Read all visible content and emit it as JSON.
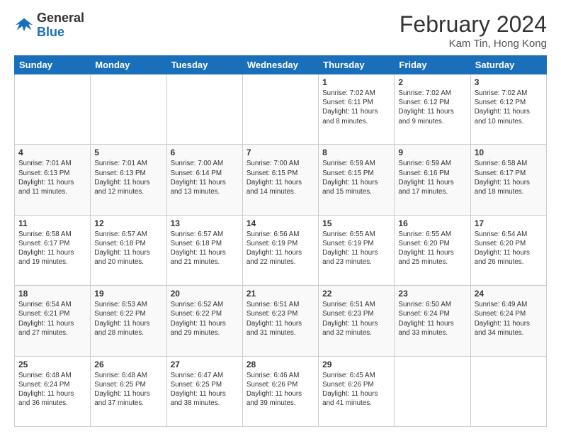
{
  "header": {
    "logo_general": "General",
    "logo_blue": "Blue",
    "month_year": "February 2024",
    "location": "Kam Tin, Hong Kong"
  },
  "days_of_week": [
    "Sunday",
    "Monday",
    "Tuesday",
    "Wednesday",
    "Thursday",
    "Friday",
    "Saturday"
  ],
  "weeks": [
    [
      {
        "day": "",
        "info": ""
      },
      {
        "day": "",
        "info": ""
      },
      {
        "day": "",
        "info": ""
      },
      {
        "day": "",
        "info": ""
      },
      {
        "day": "1",
        "info": "Sunrise: 7:02 AM\nSunset: 6:11 PM\nDaylight: 11 hours and 8 minutes."
      },
      {
        "day": "2",
        "info": "Sunrise: 7:02 AM\nSunset: 6:12 PM\nDaylight: 11 hours and 9 minutes."
      },
      {
        "day": "3",
        "info": "Sunrise: 7:02 AM\nSunset: 6:12 PM\nDaylight: 11 hours and 10 minutes."
      }
    ],
    [
      {
        "day": "4",
        "info": "Sunrise: 7:01 AM\nSunset: 6:13 PM\nDaylight: 11 hours and 11 minutes."
      },
      {
        "day": "5",
        "info": "Sunrise: 7:01 AM\nSunset: 6:13 PM\nDaylight: 11 hours and 12 minutes."
      },
      {
        "day": "6",
        "info": "Sunrise: 7:00 AM\nSunset: 6:14 PM\nDaylight: 11 hours and 13 minutes."
      },
      {
        "day": "7",
        "info": "Sunrise: 7:00 AM\nSunset: 6:15 PM\nDaylight: 11 hours and 14 minutes."
      },
      {
        "day": "8",
        "info": "Sunrise: 6:59 AM\nSunset: 6:15 PM\nDaylight: 11 hours and 15 minutes."
      },
      {
        "day": "9",
        "info": "Sunrise: 6:59 AM\nSunset: 6:16 PM\nDaylight: 11 hours and 17 minutes."
      },
      {
        "day": "10",
        "info": "Sunrise: 6:58 AM\nSunset: 6:17 PM\nDaylight: 11 hours and 18 minutes."
      }
    ],
    [
      {
        "day": "11",
        "info": "Sunrise: 6:58 AM\nSunset: 6:17 PM\nDaylight: 11 hours and 19 minutes."
      },
      {
        "day": "12",
        "info": "Sunrise: 6:57 AM\nSunset: 6:18 PM\nDaylight: 11 hours and 20 minutes."
      },
      {
        "day": "13",
        "info": "Sunrise: 6:57 AM\nSunset: 6:18 PM\nDaylight: 11 hours and 21 minutes."
      },
      {
        "day": "14",
        "info": "Sunrise: 6:56 AM\nSunset: 6:19 PM\nDaylight: 11 hours and 22 minutes."
      },
      {
        "day": "15",
        "info": "Sunrise: 6:55 AM\nSunset: 6:19 PM\nDaylight: 11 hours and 23 minutes."
      },
      {
        "day": "16",
        "info": "Sunrise: 6:55 AM\nSunset: 6:20 PM\nDaylight: 11 hours and 25 minutes."
      },
      {
        "day": "17",
        "info": "Sunrise: 6:54 AM\nSunset: 6:20 PM\nDaylight: 11 hours and 26 minutes."
      }
    ],
    [
      {
        "day": "18",
        "info": "Sunrise: 6:54 AM\nSunset: 6:21 PM\nDaylight: 11 hours and 27 minutes."
      },
      {
        "day": "19",
        "info": "Sunrise: 6:53 AM\nSunset: 6:22 PM\nDaylight: 11 hours and 28 minutes."
      },
      {
        "day": "20",
        "info": "Sunrise: 6:52 AM\nSunset: 6:22 PM\nDaylight: 11 hours and 29 minutes."
      },
      {
        "day": "21",
        "info": "Sunrise: 6:51 AM\nSunset: 6:23 PM\nDaylight: 11 hours and 31 minutes."
      },
      {
        "day": "22",
        "info": "Sunrise: 6:51 AM\nSunset: 6:23 PM\nDaylight: 11 hours and 32 minutes."
      },
      {
        "day": "23",
        "info": "Sunrise: 6:50 AM\nSunset: 6:24 PM\nDaylight: 11 hours and 33 minutes."
      },
      {
        "day": "24",
        "info": "Sunrise: 6:49 AM\nSunset: 6:24 PM\nDaylight: 11 hours and 34 minutes."
      }
    ],
    [
      {
        "day": "25",
        "info": "Sunrise: 6:48 AM\nSunset: 6:24 PM\nDaylight: 11 hours and 36 minutes."
      },
      {
        "day": "26",
        "info": "Sunrise: 6:48 AM\nSunset: 6:25 PM\nDaylight: 11 hours and 37 minutes."
      },
      {
        "day": "27",
        "info": "Sunrise: 6:47 AM\nSunset: 6:25 PM\nDaylight: 11 hours and 38 minutes."
      },
      {
        "day": "28",
        "info": "Sunrise: 6:46 AM\nSunset: 6:26 PM\nDaylight: 11 hours and 39 minutes."
      },
      {
        "day": "29",
        "info": "Sunrise: 6:45 AM\nSunset: 6:26 PM\nDaylight: 11 hours and 41 minutes."
      },
      {
        "day": "",
        "info": ""
      },
      {
        "day": "",
        "info": ""
      }
    ]
  ]
}
